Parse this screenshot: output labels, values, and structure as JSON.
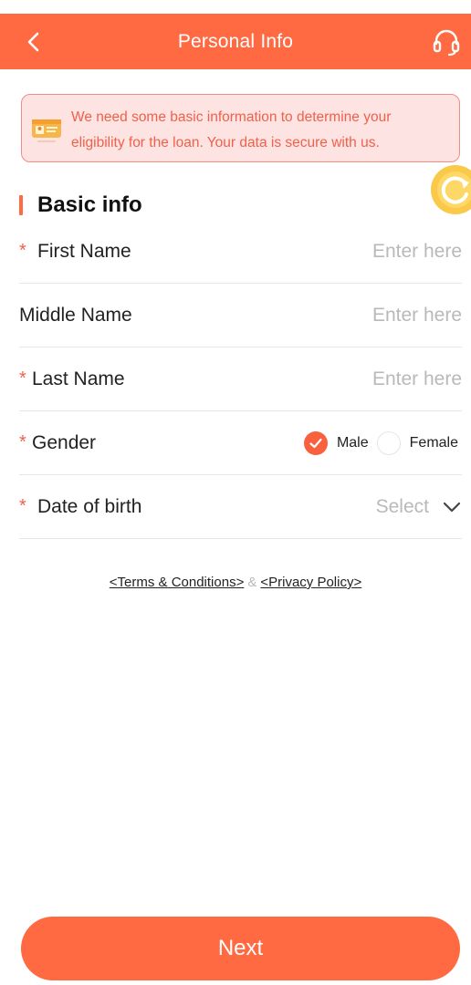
{
  "header": {
    "title": "Personal Info",
    "back_icon": "chevron-left-icon",
    "support_icon": "headset-icon"
  },
  "notice": {
    "icon": "id-card-icon",
    "text": "We need some basic information to determine your eligibility for the loan. Your data is secure with us."
  },
  "float_badge": {
    "icon": "refresh-badge-icon"
  },
  "section": {
    "title": "Basic info"
  },
  "fields": [
    {
      "label": "First Name",
      "required": true,
      "required_mark": "*",
      "placeholder": "Enter here"
    },
    {
      "label": "Middle Name",
      "required": false,
      "required_mark": "",
      "placeholder": "Enter here"
    },
    {
      "label": "Last Name",
      "required": true,
      "required_mark": "*",
      "placeholder": "Enter here"
    },
    {
      "label": "Gender",
      "required": true,
      "required_mark": "*",
      "options": [
        {
          "label": "Male",
          "selected": true
        },
        {
          "label": "Female",
          "selected": false
        }
      ]
    },
    {
      "label": "Date of birth",
      "required": true,
      "required_mark": "*",
      "placeholder": "Select",
      "icon": "chevron-down-icon"
    }
  ],
  "links": {
    "terms": "<Terms & Conditions>",
    "separator": "&",
    "privacy": "<Privacy Policy>"
  },
  "footer": {
    "next_label": "Next"
  },
  "colors": {
    "primary": "#ff6a42",
    "notice_bg": "#fde3e1",
    "notice_text": "#f0604a",
    "placeholder": "#b9b9b9"
  }
}
